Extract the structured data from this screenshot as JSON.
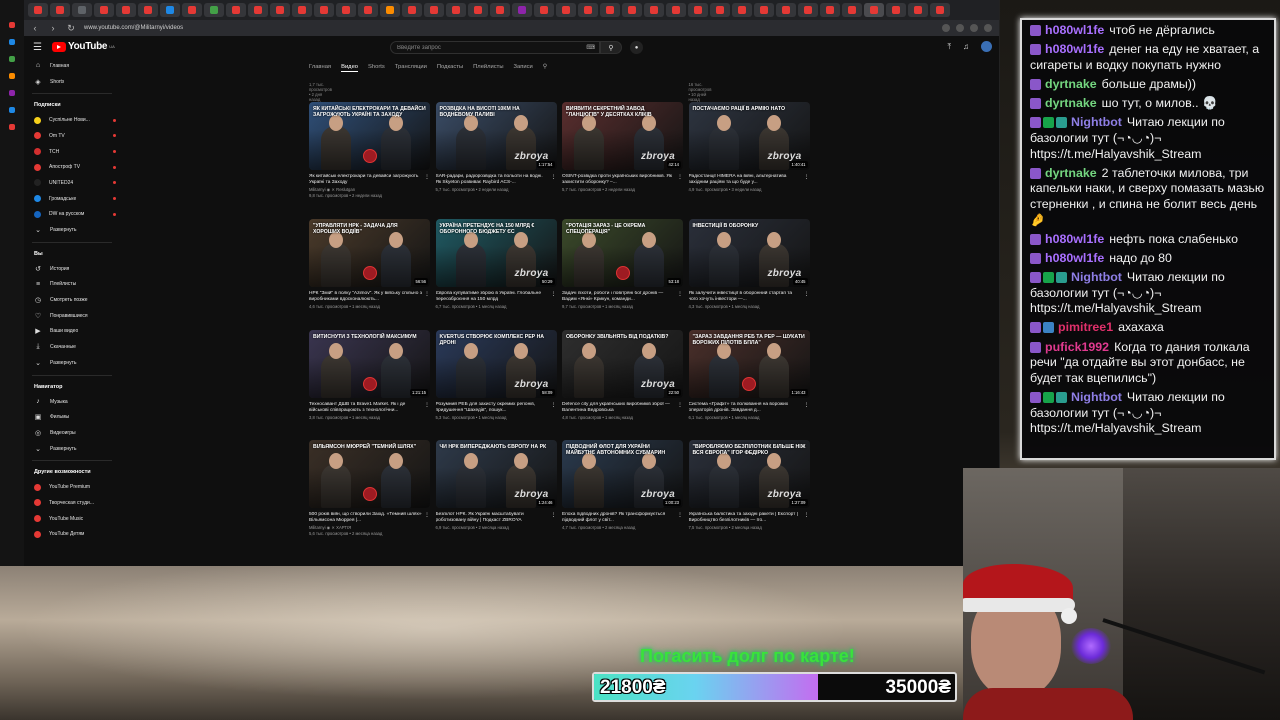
{
  "browser": {
    "url": "www.youtube.com/@Militarnyi/videos",
    "tab_colors": [
      "#e53935",
      "#e53935",
      "#5f6368",
      "#e53935",
      "#e53935",
      "#e53935",
      "#1e88e5",
      "#e53935",
      "#43a047",
      "#e53935",
      "#e53935",
      "#e53935",
      "#e53935",
      "#e53935",
      "#e53935",
      "#e53935",
      "#fb8c00",
      "#e53935",
      "#e53935",
      "#e53935",
      "#e53935",
      "#e53935",
      "#8e24aa",
      "#e53935",
      "#e53935",
      "#e53935",
      "#e53935",
      "#e53935",
      "#e53935",
      "#e53935",
      "#e53935",
      "#e53935",
      "#e53935",
      "#e53935",
      "#e53935",
      "#e53935",
      "#e53935",
      "#e53935",
      "#e53935",
      "#e53935",
      "#e53935",
      "#e53935"
    ]
  },
  "youtube": {
    "logo_text": "YouTube",
    "logo_country": "UA",
    "search_placeholder": "Введите запрос",
    "sidebar": {
      "main": [
        {
          "icon": "home-icon",
          "glyph": "⌂",
          "label": "Главная"
        },
        {
          "icon": "shorts-icon",
          "glyph": "◈",
          "label": "Shorts"
        }
      ],
      "subs_title": "Подписки",
      "subs": [
        {
          "label": "Суспільне Нови...",
          "color": "#f7d11b"
        },
        {
          "label": "Om TV",
          "color": "#e53935"
        },
        {
          "label": "TCH",
          "color": "#d32f2f"
        },
        {
          "label": "Апостроф TV",
          "color": "#e53935"
        },
        {
          "label": "UNITED24",
          "color": "#222222"
        },
        {
          "label": "Громадське",
          "color": "#1e88e5"
        },
        {
          "label": "DW на русском",
          "color": "#1565c0"
        }
      ],
      "subs_expand": "Развернуть",
      "you_title": "Вы",
      "you": [
        {
          "icon": "history-icon",
          "glyph": "↺",
          "label": "История"
        },
        {
          "icon": "playlists-icon",
          "glyph": "≡",
          "label": "Плейлисты"
        },
        {
          "icon": "watch-later-icon",
          "glyph": "◷",
          "label": "Смотреть позже"
        },
        {
          "icon": "liked-icon",
          "glyph": "♡",
          "label": "Понравившиеся"
        },
        {
          "icon": "your-videos-icon",
          "glyph": "▶",
          "label": "Ваши видео"
        },
        {
          "icon": "downloads-icon",
          "glyph": "⤓",
          "label": "Скачанные"
        }
      ],
      "you_expand": "Развернуть",
      "nav_title": "Навигатор",
      "nav": [
        {
          "icon": "music-icon",
          "glyph": "♪",
          "label": "Музыка"
        },
        {
          "icon": "films-icon",
          "glyph": "▣",
          "label": "Фильмы"
        },
        {
          "icon": "games-icon",
          "glyph": "◎",
          "label": "Видеоигры"
        }
      ],
      "nav_expand": "Развернуть",
      "more_title": "Другие возможности",
      "more": [
        {
          "label": "YouTube Premium"
        },
        {
          "label": "Творческая студи..."
        },
        {
          "label": "YouTube Music"
        },
        {
          "label": "YouTube Детям"
        }
      ]
    },
    "channel_tabs": [
      "Главная",
      "Видео",
      "Shorts",
      "Трансляции",
      "Подкасты",
      "Плейлисты",
      "Записи"
    ],
    "active_tab": "Видео",
    "top_row_stats": [
      "1,7 тыс. просмотров • 2 дня назад",
      "",
      "",
      "16 тыс. просмотров • 10 дней назад"
    ],
    "videos": [
      {
        "caption": "Як китайські електрокари та девайси загрожують Україні та Заходу",
        "brand": "",
        "dur": "",
        "bg": "#2f4f78",
        "title": "Як китайські електрокари та девайси загрожують Україні та Заходу",
        "meta1": "Militarnyi ◉ ✕ Reslutgan",
        "meta2": "9,8 тыс. просмотров • 2 недели назад"
      },
      {
        "caption": "Розвідка на висоті 10км на водневому паливі",
        "brand": "zbroya",
        "dur": "1:17:54",
        "bg": "#3a4c66",
        "title": "SAR-радари, радіорозвідка та польоти на водні. Як Skyeton розвиває Raybird ACS-...",
        "meta1": "",
        "meta2": "5,7 тыс. просмотров • 2 недели назад"
      },
      {
        "caption": "Виявити секретний завод \"Ланцюгів\" у десятках кліків",
        "brand": "zbroya",
        "dur": "42:14",
        "bg": "#5a2e2e",
        "title": "OSINT-розвідка проти українських виробників. Як захистити оборонку? –...",
        "meta1": "",
        "meta2": "5,7 тыс. просмотров • 2 недели назад"
      },
      {
        "caption": "Постачаємо рації в армію НАТО",
        "brand": "zbroya",
        "dur": "1:40:41",
        "bg": "#2d3440",
        "title": "Радіостанції HIMERA на війні, альтернатива західним раціям та що буде у...",
        "meta1": "",
        "meta2": "4,9 тыс. просмотров • 3 недели назад"
      },
      {
        "caption": "\"Управляти НРК - задача для хороших водіїв\"",
        "brand": "",
        "dur": "56:56",
        "bg": "#4a3a2a",
        "title": "НРК \"Змій\" в полку \"Azimov\". Як у війську спільно з виробниками вдосконалюють...",
        "meta1": "",
        "meta2": "4,6 тыс. просмотров • 1 месяц назад"
      },
      {
        "caption": "Україна претендує на 150 млрд € оборонного бюджету ЄС",
        "brand": "zbroya",
        "dur": "50:29",
        "bg": "#1f5a63",
        "title": "Європа купуватиме зброю в Україні. Глобальне переозброєння на 150 млрд",
        "meta1": "",
        "meta2": "6,7 тыс. просмотров • 1 месяц назад"
      },
      {
        "caption": "\"Ротація зараз - це окрема спецоперація\"",
        "brand": "",
        "dur": "53:18",
        "bg": "#3b4a2a",
        "title": "Задачі піхоти, роботи і повітряні бої дронів — Вадим «Янкі» Крикун, команди...",
        "meta1": "",
        "meta2": "9,7 тыс. просмотров • 1 месяц назад"
      },
      {
        "caption": "Інвестиції в оборонку",
        "brand": "zbroya",
        "dur": "40:45",
        "bg": "#2a2f3a",
        "title": "Як залучити інвестиції в оборонний стартап та чого хочуть інвестори —...",
        "meta1": "",
        "meta2": "4,3 тыс. просмотров • 1 месяц назад"
      },
      {
        "caption": "Витиснути з технологій максимум",
        "brand": "",
        "dur": "1:21:15",
        "bg": "#3a3550",
        "title": "Техносавант ДШВ та Brave1 Market. Як і де військові співпрацюють з технологічни...",
        "meta1": "",
        "meta2": "3,8 тыс. просмотров • 1 месяц назад"
      },
      {
        "caption": "Kvertus створює комплекс РЕР на дроні",
        "brand": "zbroya",
        "dur": "58:09",
        "bg": "#2a3a5a",
        "title": "Розумний РЕБ для захисту окремих регіонів, придушення \"Шахедів\", пошук...",
        "meta1": "",
        "meta2": "5,3 тыс. просмотров • 1 месяц назад"
      },
      {
        "caption": "Оборонку звільнять від податків?",
        "brand": "zbroya",
        "dur": "22:50",
        "bg": "#2e2e2e",
        "title": "Defence city для українських виробників зброї — Валентина Ведровська",
        "meta1": "",
        "meta2": "4,8 тыс. просмотров • 1 месяц назад"
      },
      {
        "caption": "\"Зараз завдання РЕБ та РЕР — шукати ворожих пілотів БпЛА\"",
        "brand": "",
        "dur": "1:16:43",
        "bg": "#4a2f2a",
        "title": "Система «Графіт» та полювання на ворожих операторів дронів. Завдання д...",
        "meta1": "",
        "meta2": "6,1 тыс. просмотров • 1 месяц назад"
      },
      {
        "caption": "Вільямсон Мюррей \"Темний шлях\"",
        "brand": "",
        "dur": "",
        "bg": "#3a2f26",
        "title": "500 років війн, що створили Захід. «Темний шлях» Вільямсона Мюррея |...",
        "meta1": "Militarnyi ◉ ✕ ХАРТІЯ",
        "meta2": "5,6 тыс. просмотров • 2 месяца назад"
      },
      {
        "caption": "Чи НРК випереджають Європу на РК",
        "brand": "zbroya",
        "dur": "1:24:46",
        "bg": "#2e3a4a",
        "title": "Безпілот НРК. Як Україні масштабувати роботизовану війну | Подкаст ZBROYA",
        "meta1": "",
        "meta2": "6,9 тыс. просмотров • 2 месяца назад"
      },
      {
        "caption": "Підводний флот для України майбутнє автономних субмарин",
        "brand": "zbroya",
        "dur": "1:00:23",
        "bg": "#2a3a4e",
        "title": "Епоха підводних дронів? Як трансформується підводний флот у світ...",
        "meta1": "",
        "meta2": "4,7 тыс. просмотров • 2 месяца назад"
      },
      {
        "caption": "\"Виробляємо безпілотник більше ніж вся Європа\" Ігор Федірко",
        "brand": "zbroya",
        "dur": "1:27:09",
        "bg": "#2a2f3a",
        "title": "Українська балістика та західні ракети | Експорт | Виробництво безпілотників — Іго...",
        "meta1": "",
        "meta2": "7,5 тыс. просмотров • 2 месяца назад"
      }
    ]
  },
  "chat": {
    "messages": [
      {
        "user": "h080wl1fe",
        "color": "#a970ff",
        "badges": [
          "sub"
        ],
        "text": "чтоб не дёргались"
      },
      {
        "user": "h080wl1fe",
        "color": "#a970ff",
        "badges": [
          "sub"
        ],
        "text": "денег на еду не хватает, а сигареты и водку покупать нужно"
      },
      {
        "user": "dyrtnake",
        "color": "#74d680",
        "badges": [
          "sub"
        ],
        "text": "больше драмы))"
      },
      {
        "user": "dyrtnake",
        "color": "#74d680",
        "badges": [
          "sub"
        ],
        "text": "шо тут, о милов.. 💀"
      },
      {
        "user": "Nightbot",
        "color": "#8f7fe6",
        "badges": [
          "sub",
          "mod",
          "bot"
        ],
        "text": "Читаю лекции по базологии тут (¬◔◡◔)¬ https://t.me/Halyavshik_Stream"
      },
      {
        "user": "dyrtnake",
        "color": "#74d680",
        "badges": [
          "sub"
        ],
        "text": "2 таблеточки милова, три капельки наки, и сверху помазать мазью стерненки , и спина не болит весь день 🤌"
      },
      {
        "user": "h080wl1fe",
        "color": "#a970ff",
        "badges": [
          "sub"
        ],
        "text": "нефть пока слабенько"
      },
      {
        "user": "h080wl1fe",
        "color": "#a970ff",
        "badges": [
          "sub"
        ],
        "text": "надо до 80"
      },
      {
        "user": "Nightbot",
        "color": "#8f7fe6",
        "badges": [
          "sub",
          "mod",
          "bot"
        ],
        "text": "Читаю лекции по базологии тут (¬◔◡◔)¬ https://t.me/Halyavshik_Stream"
      },
      {
        "user": "pimitree1",
        "color": "#e0306b",
        "badges": [
          "sub",
          "prime"
        ],
        "text": "ахахаха"
      },
      {
        "user": "pufick1992",
        "color": "#e03a8f",
        "badges": [
          "sub"
        ],
        "text": "Когда то дания толкала речи \"да отдайте вы этот донбасс, не будет так вцепились\")"
      },
      {
        "user": "Nightbot",
        "color": "#8f7fe6",
        "badges": [
          "sub",
          "mod",
          "bot"
        ],
        "text": "Читаю лекции по базологии тут (¬◔◡◔)¬ https://t.me/Halyavshik_Stream"
      }
    ]
  },
  "donation_goal": {
    "title": "Погасить долг по карте!",
    "current": "21800₴",
    "target": "35000₴",
    "progress": 0.62
  }
}
